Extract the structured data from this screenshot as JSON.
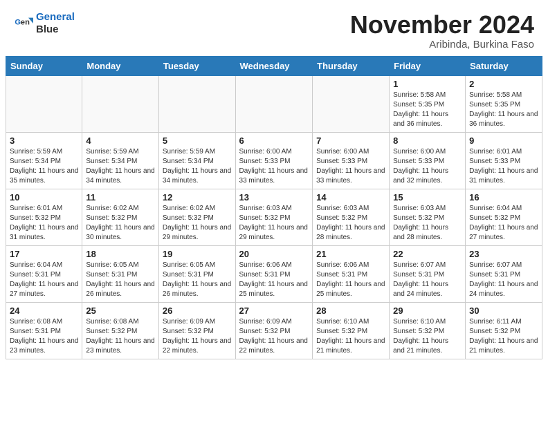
{
  "header": {
    "logo_line1": "General",
    "logo_line2": "Blue",
    "month": "November 2024",
    "location": "Aribinda, Burkina Faso"
  },
  "weekdays": [
    "Sunday",
    "Monday",
    "Tuesday",
    "Wednesday",
    "Thursday",
    "Friday",
    "Saturday"
  ],
  "weeks": [
    [
      {
        "day": "",
        "info": ""
      },
      {
        "day": "",
        "info": ""
      },
      {
        "day": "",
        "info": ""
      },
      {
        "day": "",
        "info": ""
      },
      {
        "day": "",
        "info": ""
      },
      {
        "day": "1",
        "info": "Sunrise: 5:58 AM\nSunset: 5:35 PM\nDaylight: 11 hours and 36 minutes."
      },
      {
        "day": "2",
        "info": "Sunrise: 5:58 AM\nSunset: 5:35 PM\nDaylight: 11 hours and 36 minutes."
      }
    ],
    [
      {
        "day": "3",
        "info": "Sunrise: 5:59 AM\nSunset: 5:34 PM\nDaylight: 11 hours and 35 minutes."
      },
      {
        "day": "4",
        "info": "Sunrise: 5:59 AM\nSunset: 5:34 PM\nDaylight: 11 hours and 34 minutes."
      },
      {
        "day": "5",
        "info": "Sunrise: 5:59 AM\nSunset: 5:34 PM\nDaylight: 11 hours and 34 minutes."
      },
      {
        "day": "6",
        "info": "Sunrise: 6:00 AM\nSunset: 5:33 PM\nDaylight: 11 hours and 33 minutes."
      },
      {
        "day": "7",
        "info": "Sunrise: 6:00 AM\nSunset: 5:33 PM\nDaylight: 11 hours and 33 minutes."
      },
      {
        "day": "8",
        "info": "Sunrise: 6:00 AM\nSunset: 5:33 PM\nDaylight: 11 hours and 32 minutes."
      },
      {
        "day": "9",
        "info": "Sunrise: 6:01 AM\nSunset: 5:33 PM\nDaylight: 11 hours and 31 minutes."
      }
    ],
    [
      {
        "day": "10",
        "info": "Sunrise: 6:01 AM\nSunset: 5:32 PM\nDaylight: 11 hours and 31 minutes."
      },
      {
        "day": "11",
        "info": "Sunrise: 6:02 AM\nSunset: 5:32 PM\nDaylight: 11 hours and 30 minutes."
      },
      {
        "day": "12",
        "info": "Sunrise: 6:02 AM\nSunset: 5:32 PM\nDaylight: 11 hours and 29 minutes."
      },
      {
        "day": "13",
        "info": "Sunrise: 6:03 AM\nSunset: 5:32 PM\nDaylight: 11 hours and 29 minutes."
      },
      {
        "day": "14",
        "info": "Sunrise: 6:03 AM\nSunset: 5:32 PM\nDaylight: 11 hours and 28 minutes."
      },
      {
        "day": "15",
        "info": "Sunrise: 6:03 AM\nSunset: 5:32 PM\nDaylight: 11 hours and 28 minutes."
      },
      {
        "day": "16",
        "info": "Sunrise: 6:04 AM\nSunset: 5:32 PM\nDaylight: 11 hours and 27 minutes."
      }
    ],
    [
      {
        "day": "17",
        "info": "Sunrise: 6:04 AM\nSunset: 5:31 PM\nDaylight: 11 hours and 27 minutes."
      },
      {
        "day": "18",
        "info": "Sunrise: 6:05 AM\nSunset: 5:31 PM\nDaylight: 11 hours and 26 minutes."
      },
      {
        "day": "19",
        "info": "Sunrise: 6:05 AM\nSunset: 5:31 PM\nDaylight: 11 hours and 26 minutes."
      },
      {
        "day": "20",
        "info": "Sunrise: 6:06 AM\nSunset: 5:31 PM\nDaylight: 11 hours and 25 minutes."
      },
      {
        "day": "21",
        "info": "Sunrise: 6:06 AM\nSunset: 5:31 PM\nDaylight: 11 hours and 25 minutes."
      },
      {
        "day": "22",
        "info": "Sunrise: 6:07 AM\nSunset: 5:31 PM\nDaylight: 11 hours and 24 minutes."
      },
      {
        "day": "23",
        "info": "Sunrise: 6:07 AM\nSunset: 5:31 PM\nDaylight: 11 hours and 24 minutes."
      }
    ],
    [
      {
        "day": "24",
        "info": "Sunrise: 6:08 AM\nSunset: 5:31 PM\nDaylight: 11 hours and 23 minutes."
      },
      {
        "day": "25",
        "info": "Sunrise: 6:08 AM\nSunset: 5:32 PM\nDaylight: 11 hours and 23 minutes."
      },
      {
        "day": "26",
        "info": "Sunrise: 6:09 AM\nSunset: 5:32 PM\nDaylight: 11 hours and 22 minutes."
      },
      {
        "day": "27",
        "info": "Sunrise: 6:09 AM\nSunset: 5:32 PM\nDaylight: 11 hours and 22 minutes."
      },
      {
        "day": "28",
        "info": "Sunrise: 6:10 AM\nSunset: 5:32 PM\nDaylight: 11 hours and 21 minutes."
      },
      {
        "day": "29",
        "info": "Sunrise: 6:10 AM\nSunset: 5:32 PM\nDaylight: 11 hours and 21 minutes."
      },
      {
        "day": "30",
        "info": "Sunrise: 6:11 AM\nSunset: 5:32 PM\nDaylight: 11 hours and 21 minutes."
      }
    ]
  ]
}
